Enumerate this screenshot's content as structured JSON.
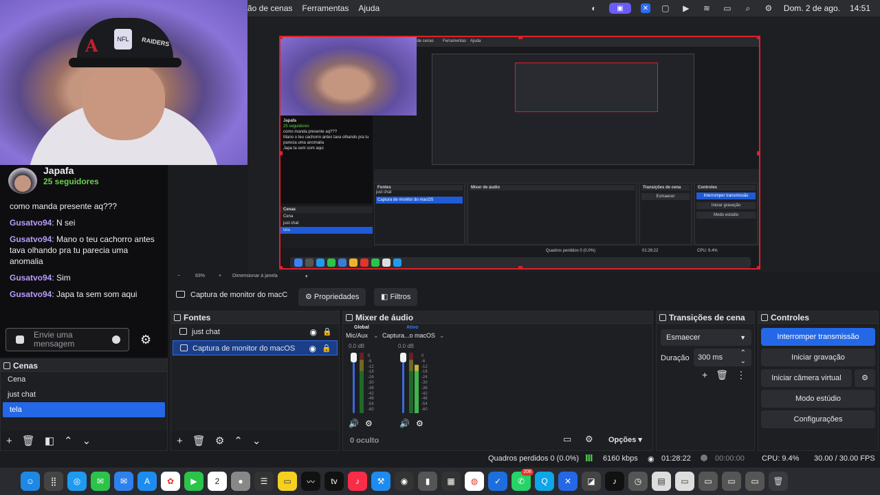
{
  "menubar": {
    "items": [
      "ão de cenas",
      "Ferramentas",
      "Ajuda"
    ],
    "datetime": "Dom. 2 de ago.",
    "time": "14:51"
  },
  "chat": {
    "channel_name": "Japafa",
    "followers": "25 seguidores",
    "messages": [
      {
        "user": "",
        "text": "como manda presente aq???"
      },
      {
        "user": "Gusatvo94",
        "text": "N sei"
      },
      {
        "user": "Gusatvo94",
        "text": "Mano o teu cachorro antes tava olhando pra tu parecia uma anomalia"
      },
      {
        "user": "Gusatvo94",
        "text": "Sim"
      },
      {
        "user": "Gusatvo94",
        "text": "Japa ta sem som aqui"
      }
    ],
    "input_placeholder": "Envie uma mensagem"
  },
  "preview": {
    "zoom": "83%",
    "resize_label": "Dimensionar à janela"
  },
  "source_bar": {
    "current_source": "Captura de monitor do macC",
    "properties": "Propriedades",
    "filters": "Filtros"
  },
  "scenes": {
    "title": "Cenas",
    "items": [
      "Cena",
      "just chat",
      "tela"
    ],
    "selected": "tela"
  },
  "sources": {
    "title": "Fontes",
    "items": [
      "just chat",
      "Captura de monitor do macOS"
    ],
    "selected": "Captura de monitor do macOS"
  },
  "mixer": {
    "title": "Mixer de áudio",
    "tab_global": "Global",
    "tab_active": "Ativo",
    "channels": [
      {
        "name": "Mic/Aux",
        "db": "0.0 dB",
        "level": 0.8
      },
      {
        "name": "Captura...o macOS",
        "db": "0.0 dB",
        "level": 0.8
      }
    ],
    "scale": [
      "0",
      "-6",
      "-12",
      "-18",
      "-24",
      "-30",
      "-36",
      "-42",
      "-48",
      "-54",
      "-60"
    ],
    "hidden": "0 oculto",
    "options": "Opções"
  },
  "transitions": {
    "title": "Transições de cena",
    "selected": "Esmaecer",
    "duration_label": "Duração",
    "duration": "300 ms"
  },
  "controls": {
    "title": "Controles",
    "stop_stream": "Interromper transmissão",
    "start_recording": "Iniciar gravação",
    "virtual_camera": "Iniciar câmera virtual",
    "studio_mode": "Modo estúdio",
    "settings": "Configurações"
  },
  "status": {
    "dropped_frames": "Quadros perdidos 0 (0.0%)",
    "bitrate": "6160 kbps",
    "stream_time": "01:28:22",
    "rec_time": "00:00:00",
    "cpu": "CPU: 9.4%",
    "fps": "30.00 / 30.00 FPS"
  },
  "dock": {
    "whatsapp_badge": "208",
    "calendar_day": "2",
    "apps": [
      "finder-icon",
      "launchpad-icon",
      "safari-icon",
      "messages-icon",
      "mail-icon",
      "appstore-icon",
      "photos-icon",
      "facetime-icon",
      "calendar-icon",
      "contacts-icon",
      "reminders-icon",
      "notes-icon",
      "stocks-icon",
      "tv-icon",
      "music-icon",
      "xcode-icon",
      "obs-icon",
      "chrome-icon",
      "whatsapp-icon",
      "vscode-icon",
      "tiktok-icon",
      "trash-icon"
    ]
  },
  "colors": {
    "accent": "#2468e8",
    "preview_border": "#e0202a",
    "followers": "#6bd04a",
    "chat_user": "#b89cff"
  }
}
